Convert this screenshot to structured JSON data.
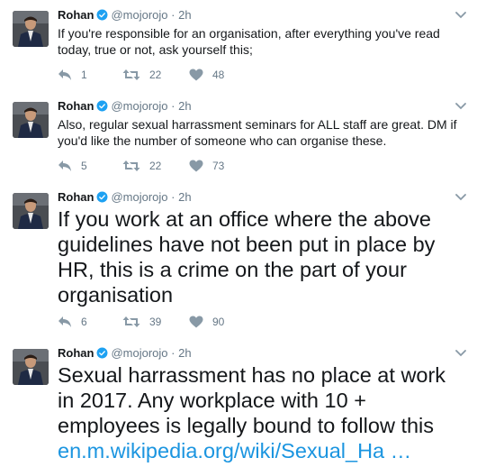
{
  "tweets": [
    {
      "name": "Rohan",
      "handle": "@mojorojo",
      "sep": "·",
      "time": "2h",
      "text": "If you're responsible for an organisation, after everything you've read today, true or not, ask yourself this;",
      "replies": "1",
      "retweets": "22",
      "likes": "48"
    },
    {
      "name": "Rohan",
      "handle": "@mojorojo",
      "sep": "·",
      "time": "2h",
      "text": "Also, regular sexual harrassment seminars for ALL staff are great. DM if you'd like the number of someone who can organise these.",
      "replies": "5",
      "retweets": "22",
      "likes": "73"
    },
    {
      "name": "Rohan",
      "handle": "@mojorojo",
      "sep": "·",
      "time": "2h",
      "text": "If you work at an office where the above guidelines have not been put in place by HR, this is a crime on the part of your organisation",
      "replies": "6",
      "retweets": "39",
      "likes": "90"
    },
    {
      "name": "Rohan",
      "handle": "@mojorojo",
      "sep": "·",
      "time": "2h",
      "text": "Sexual harrassment has no place at work in 2017. Any workplace with 10 + employees is legally bound to follow this",
      "link": "en.m.wikipedia.org/wiki/Sexual_Ha …"
    }
  ],
  "colors": {
    "text": "#14171a",
    "muted": "#657786",
    "link": "#1b95e0",
    "verified": "#1da1f2",
    "border": "#e6ecf0"
  },
  "icons": [
    "verified-badge-icon",
    "chevron-down-icon",
    "reply-icon",
    "retweet-icon",
    "heart-icon",
    "avatar"
  ]
}
